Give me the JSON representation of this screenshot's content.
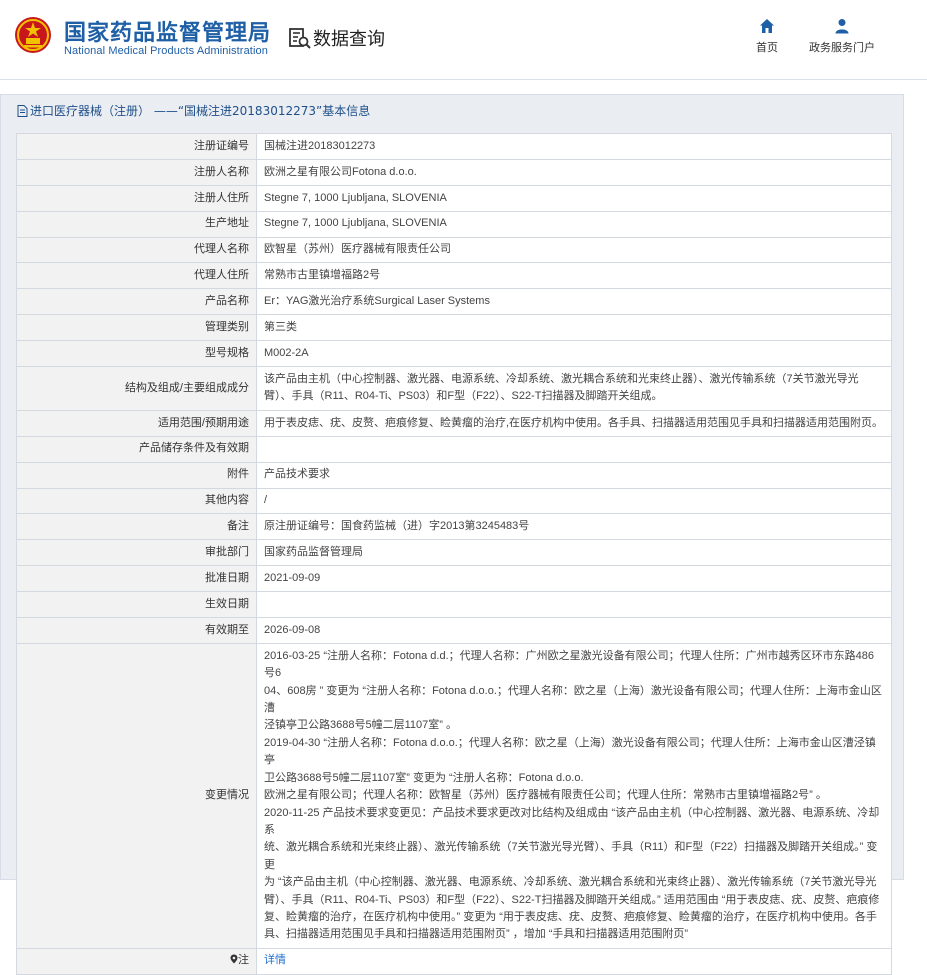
{
  "header": {
    "logo_cn": "国家药品监督管理局",
    "logo_en": "National Medical Products Administration",
    "query_title": "数据查询",
    "nav_home": "首页",
    "nav_portal": "政务服务门户",
    "emblem_icon": "national-emblem-icon",
    "accent_color": "#1f5fa6"
  },
  "panel": {
    "title": "进口医疗器械（注册） ——“国械注进20183012273”基本信息"
  },
  "rows": [
    {
      "key": "注册证编号",
      "value": "国械注进20183012273"
    },
    {
      "key": "注册人名称",
      "value": "欧洲之星有限公司Fotona d.o.o."
    },
    {
      "key": "注册人住所",
      "value": "Stegne 7, 1000 Ljubljana, SLOVENIA"
    },
    {
      "key": "生产地址",
      "value": "Stegne 7, 1000 Ljubljana, SLOVENIA"
    },
    {
      "key": "代理人名称",
      "value": "欧智星（苏州）医疗器械有限责任公司"
    },
    {
      "key": "代理人住所",
      "value": "常熟市古里镇增福路2号"
    },
    {
      "key": "产品名称",
      "value": "Er：YAG激光治疗系统Surgical Laser Systems"
    },
    {
      "key": "管理类别",
      "value": "第三类"
    },
    {
      "key": "型号规格",
      "value": "M002-2A"
    },
    {
      "key": "结构及组成/主要组成成分",
      "value": "该产品由主机（中心控制器、激光器、电源系统、冷却系统、激光耦合系统和光束终止器）、激光传输系统（7关节激光导光臂）、手具（R11、R04-Ti、PS03）和F型（F22）、S22-T扫描器及脚踏开关组成。"
    },
    {
      "key": "适用范围/预期用途",
      "value": "用于表皮痣、疣、皮赘、疤痕修复、睑黄瘤的治疗,在医疗机构中使用。各手具、扫描器适用范围见手具和扫描器适用范围附页。"
    },
    {
      "key": "产品储存条件及有效期",
      "value": ""
    },
    {
      "key": "附件",
      "value": "产品技术要求"
    },
    {
      "key": "其他内容",
      "value": "/"
    },
    {
      "key": "备注",
      "value": "原注册证编号：国食药监械（进）字2013第3245483号"
    },
    {
      "key": "审批部门",
      "value": "国家药品监督管理局"
    },
    {
      "key": "批准日期",
      "value": "2021-09-09"
    },
    {
      "key": "生效日期",
      "value": ""
    },
    {
      "key": "有效期至",
      "value": "2026-09-08"
    }
  ],
  "changes": {
    "key": "变更情况",
    "lines": [
      "2016-03-25 “注册人名称：Fotona d.d.；代理人名称：广州欧之星激光设备有限公司；代理人住所：广州市越秀区环市东路486号6",
      "04、608房 ” 变更为 “注册人名称：Fotona d.o.o.；代理人名称：欧之星（上海）激光设备有限公司；代理人住所：上海市金山区漕",
      "泾镇亭卫公路3688号5幢二层1107室” 。",
      "2019-04-30 “注册人名称：Fotona d.o.o.；代理人名称：欧之星（上海）激光设备有限公司；代理人住所：上海市金山区漕泾镇亭",
      "卫公路3688号5幢二层1107室” 变更为 “注册人名称：Fotona d.o.o.",
      "欧洲之星有限公司；代理人名称：欧智星（苏州）医疗器械有限责任公司；代理人住所：常熟市古里镇增福路2号” 。",
      "2020-11-25 产品技术要求变更见：产品技术要求更改对比结构及组成由 “该产品由主机（中心控制器、激光器、电源系统、冷却系",
      "统、激光耦合系统和光束终止器）、激光传输系统（7关节激光导光臂）、手具（R11）和F型（F22）扫描器及脚踏开关组成。” 变更",
      "为 “该产品由主机（中心控制器、激光器、电源系统、冷却系统、激光耦合系统和光束终止器）、激光传输系统（7关节激光导光",
      "臂）、手具（R11、R04-Ti、PS03）和F型（F22）、S22-T扫描器及脚踏开关组成。” 适用范围由 “用于表皮痣、疣、皮赘、疤痕修",
      "复、睑黄瘤的治疗，在医疗机构中使用。” 变更为 “用于表皮痣、疣、皮赘、疤痕修复、睑黄瘤的治疗，在医疗机构中使用。各手",
      "具、扫描器适用范围见手具和扫描器适用范围附页” ，增加 “手具和扫描器适用范围附页”"
    ]
  },
  "note": {
    "key": "注",
    "icon": "pin-icon",
    "link": "详情"
  }
}
